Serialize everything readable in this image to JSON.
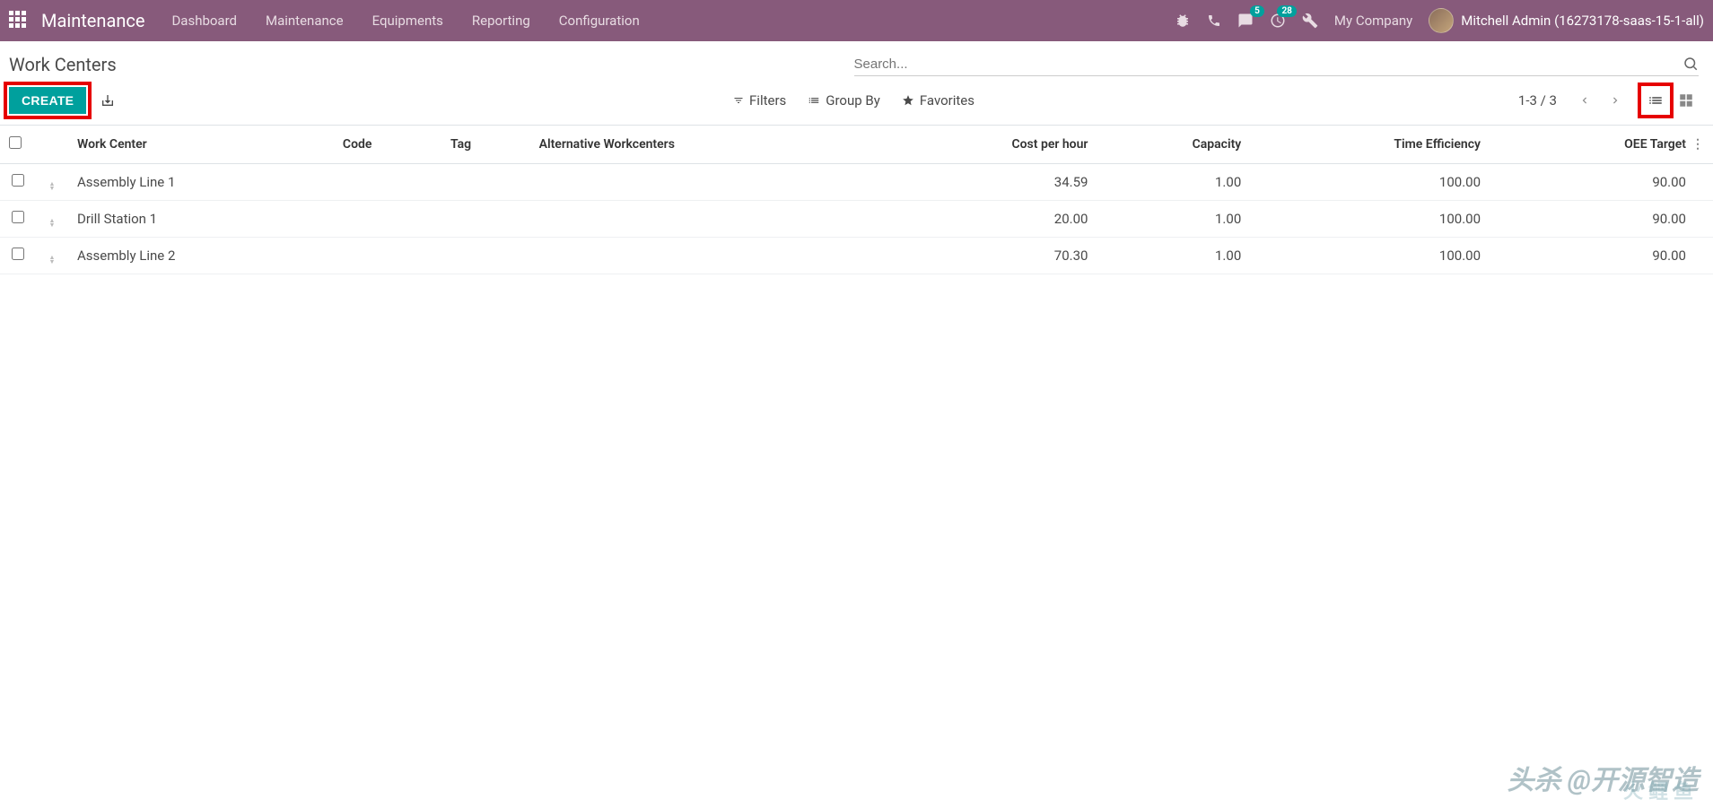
{
  "navbar": {
    "brand": "Maintenance",
    "menu": [
      "Dashboard",
      "Maintenance",
      "Equipments",
      "Reporting",
      "Configuration"
    ],
    "msg_badge": "5",
    "activity_badge": "28",
    "company": "My Company",
    "user": "Mitchell Admin (16273178-saas-15-1-all)"
  },
  "breadcrumb": "Work Centers",
  "search": {
    "placeholder": "Search..."
  },
  "toolbar": {
    "create": "CREATE",
    "filters": "Filters",
    "groupby": "Group By",
    "favorites": "Favorites",
    "pager": "1-3 / 3"
  },
  "table": {
    "headers": {
      "name": "Work Center",
      "code": "Code",
      "tag": "Tag",
      "alt": "Alternative Workcenters",
      "cost": "Cost per hour",
      "capacity": "Capacity",
      "eff": "Time Efficiency",
      "oee": "OEE Target"
    },
    "rows": [
      {
        "name": "Assembly Line 1",
        "code": "",
        "tag": "",
        "alt": "",
        "cost": "34.59",
        "capacity": "1.00",
        "eff": "100.00",
        "oee": "90.00"
      },
      {
        "name": "Drill Station 1",
        "code": "",
        "tag": "",
        "alt": "",
        "cost": "20.00",
        "capacity": "1.00",
        "eff": "100.00",
        "oee": "90.00"
      },
      {
        "name": "Assembly Line 2",
        "code": "",
        "tag": "",
        "alt": "",
        "cost": "70.30",
        "capacity": "1.00",
        "eff": "100.00",
        "oee": "90.00"
      }
    ]
  },
  "watermark": "头杀 @开源智造",
  "watermark2": "火鲤鱼"
}
